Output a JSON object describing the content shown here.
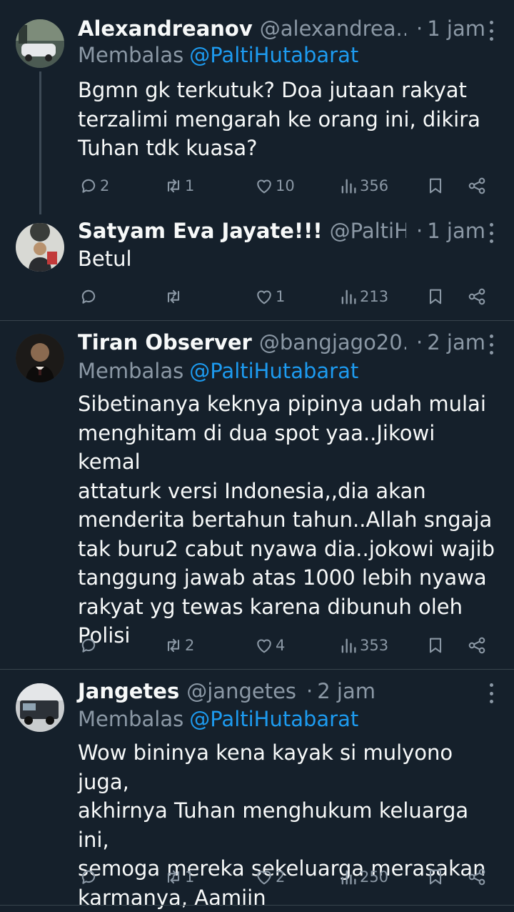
{
  "tweets": [
    {
      "name": "Alexandreanov",
      "handle": "@alexandrea...",
      "time": "1 jam",
      "replying_label": "Membalas",
      "replying_to": "@PaltiHutabarat",
      "text": "Bgmn gk terkutuk?  Doa jutaan rakyat\nterzalimi mengarah ke orang ini,  dikira\nTuhan tdk kuasa?",
      "replies": "2",
      "retweets": "1",
      "likes": "10",
      "views": "356"
    },
    {
      "name": "Satyam Eva Jayate!!!",
      "handle": "@PaltiH...",
      "time": "1 jam",
      "text": "Betul",
      "replies": "",
      "retweets": "",
      "likes": "1",
      "views": "213"
    },
    {
      "name": "Tiran Observer",
      "handle": "@bangjago20...",
      "time": "2 jam",
      "replying_label": "Membalas",
      "replying_to": "@PaltiHutabarat",
      "text": "Sibetinanya keknya pipinya udah mulai\nmenghitam di dua spot yaa..Jikowi kemal\nattaturk versi Indonesia,,dia akan\nmenderita bertahun tahun..Allah sngaja\ntak buru2 cabut nyawa dia..jokowi wajib\ntanggung jawab atas 1000 lebih nyawa\nrakyat yg tewas karena dibunuh oleh\nPolisi",
      "replies": "",
      "retweets": "2",
      "likes": "4",
      "views": "353"
    },
    {
      "name": "Jangetes",
      "handle": "@jangetes",
      "time": "2 jam",
      "replying_label": "Membalas",
      "replying_to": "@PaltiHutabarat",
      "text": "Wow bininya kena kayak si mulyono juga,\nakhirnya Tuhan menghukum keluarga ini,\nsemoga mereka sekeluarga merasakan\nkarmanya, Aamiin",
      "replies": "",
      "retweets": "1",
      "likes": "2",
      "views": "250"
    }
  ],
  "theme": {
    "background": "#15202b",
    "text": "#f7f9f9",
    "secondary": "#8b98a5",
    "accent": "#1d9bf0",
    "divider": "#38444d"
  },
  "icons": [
    "reply-icon",
    "retweet-icon",
    "like-icon",
    "views-icon",
    "bookmark-icon",
    "share-icon",
    "more-icon"
  ]
}
